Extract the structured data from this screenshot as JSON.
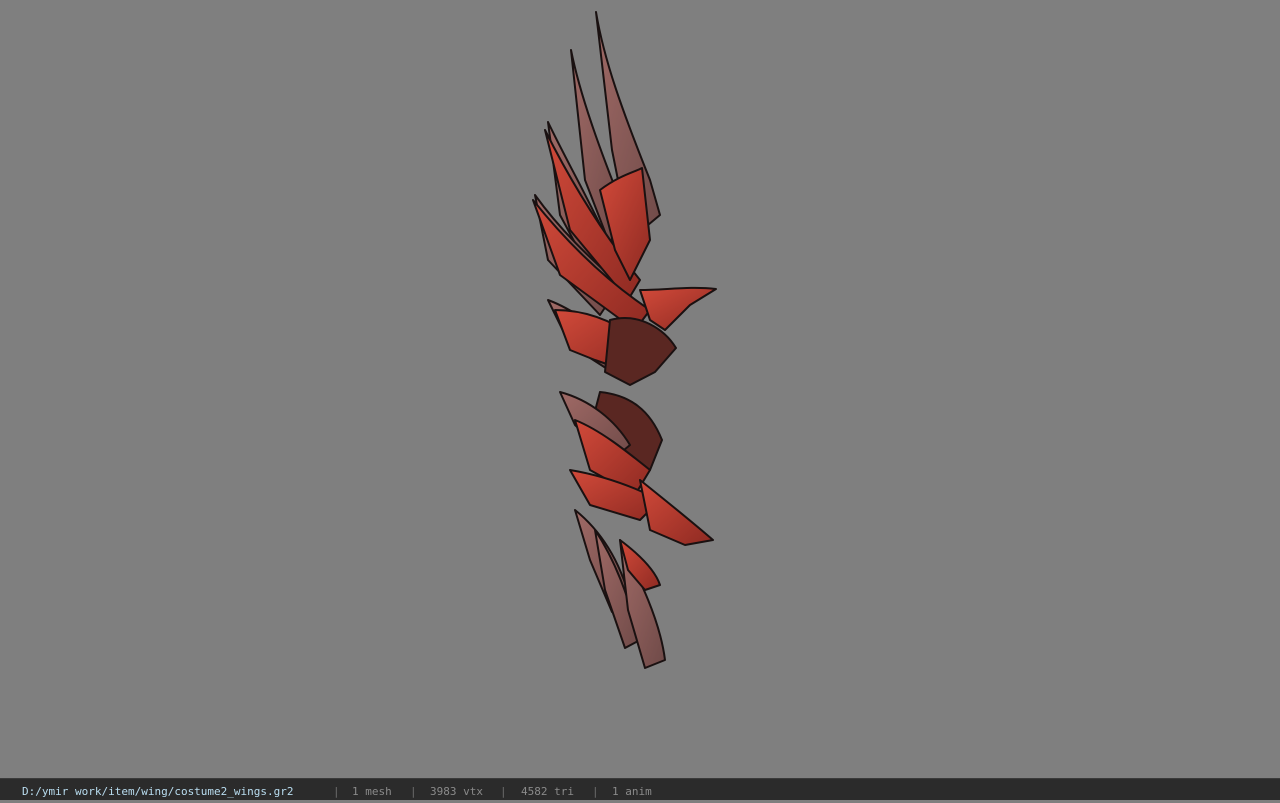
{
  "viewer": {
    "background_color": "#7f7f7f",
    "model_icon": "red-feather-wings-model",
    "model_colors": {
      "feather_red": "#b8372c",
      "feather_gray": "#8a5a57",
      "outline": "#1a1111"
    }
  },
  "status_bar": {
    "file_path": "D:/ymir work/item/wing/costume2_wings.gr2",
    "separator": "|",
    "mesh_count": "1 mesh",
    "vertex_count": "3983 vtx",
    "triangle_count": "4582 tri",
    "anim_count": "1 anim"
  }
}
